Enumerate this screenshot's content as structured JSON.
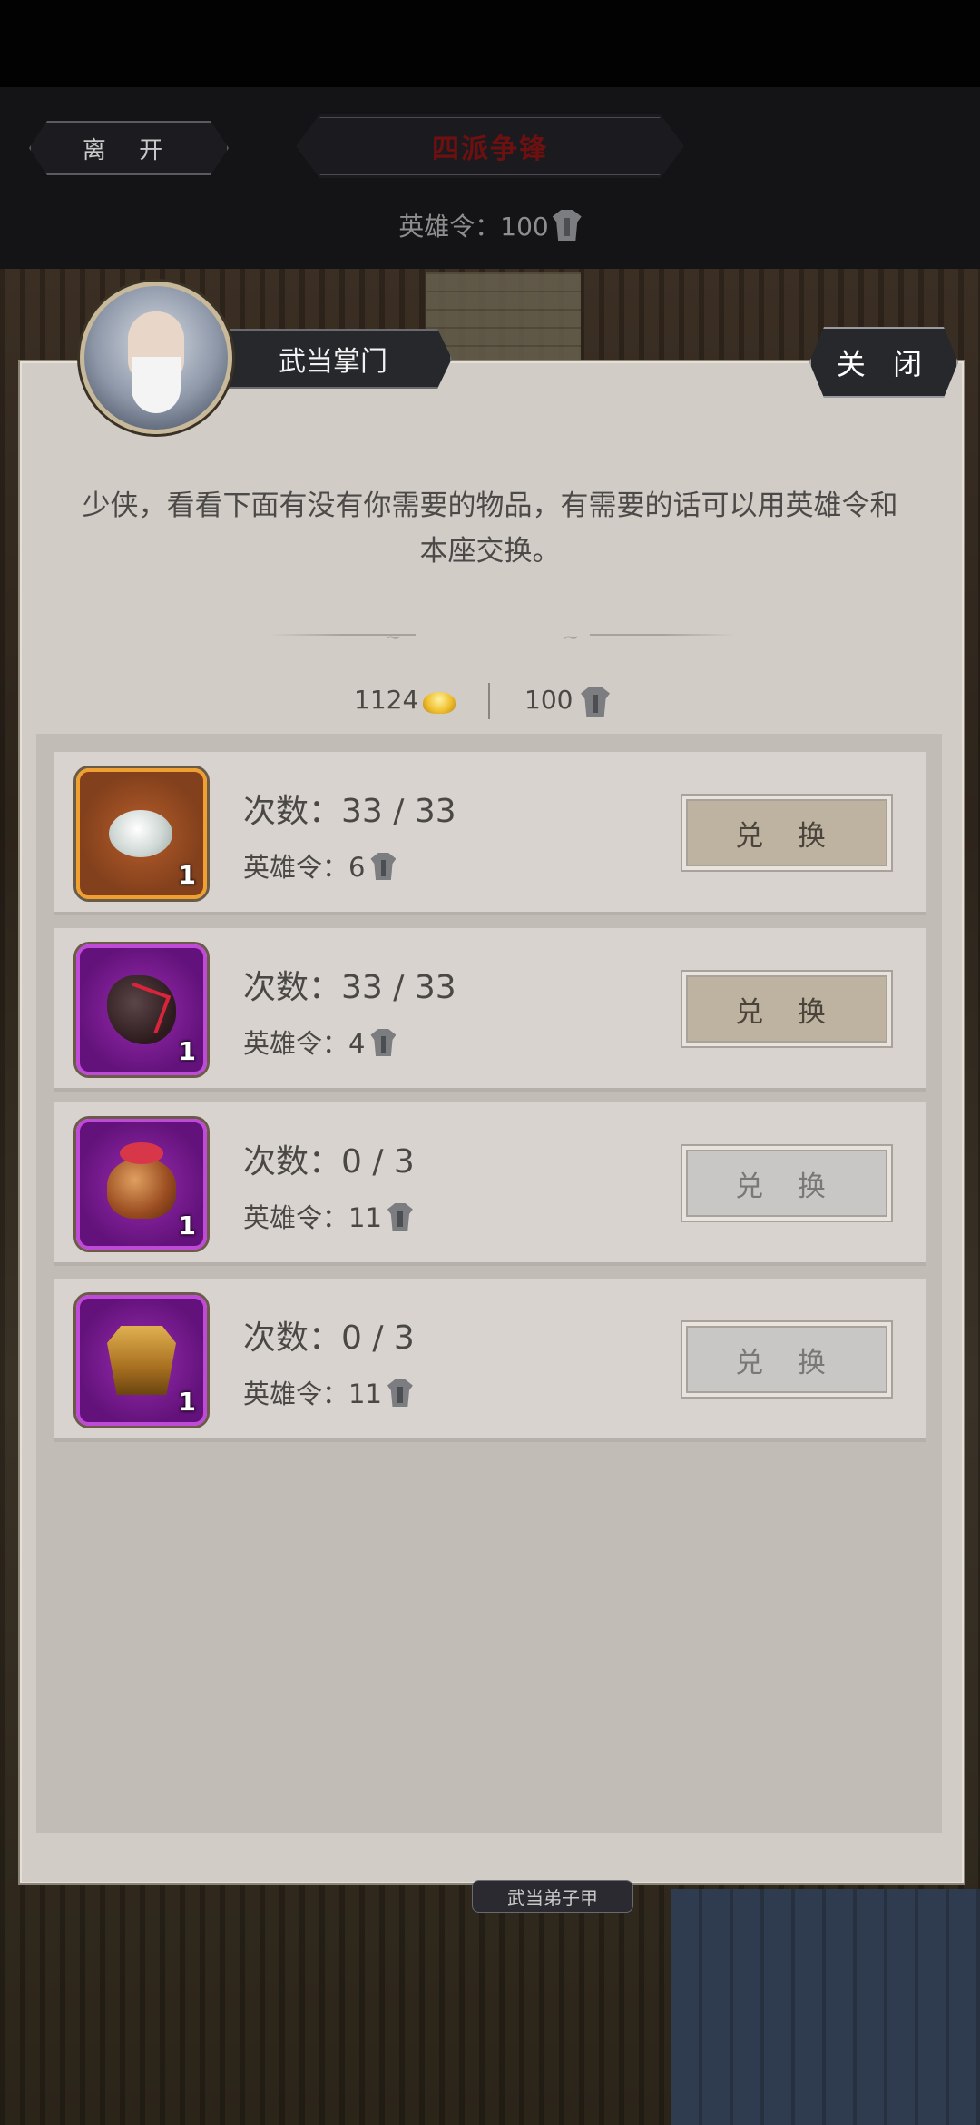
{
  "top_bar": {
    "leave_label": "离 开",
    "title": "四派争锋",
    "hero_token_text": "英雄令：100"
  },
  "dialog": {
    "npc_name": "武当掌门",
    "close_label": "关 闭",
    "message": "少侠，看看下面有没有你需要的物品，有需要的话可以用英雄令和本座交换。",
    "currency": {
      "gold": "1124",
      "hero_tokens": "100"
    },
    "items": [
      {
        "icon": "jade-ring-icon",
        "rarity": "orange",
        "quantity": "1",
        "count": "次数：33 / 33",
        "cost": "英雄令：6",
        "button": "兑 换",
        "enabled": true
      },
      {
        "icon": "ore-stone-icon",
        "rarity": "purple",
        "quantity": "1",
        "count": "次数：33 / 33",
        "cost": "英雄令：4",
        "button": "兑 换",
        "enabled": true
      },
      {
        "icon": "wine-jar-icon",
        "rarity": "purple",
        "quantity": "1",
        "count": "次数：0 / 3",
        "cost": "英雄令：11",
        "button": "兑 换",
        "enabled": false
      },
      {
        "icon": "golden-armor-icon",
        "rarity": "purple",
        "quantity": "1",
        "count": "次数：0 / 3",
        "cost": "英雄令：11",
        "button": "兑 换",
        "enabled": false
      }
    ]
  },
  "bottom_tag": "武当弟子甲",
  "colors": {
    "title_red": "#6e1010",
    "orange_rarity": "#f0a030",
    "purple_rarity": "#c04ad8"
  }
}
